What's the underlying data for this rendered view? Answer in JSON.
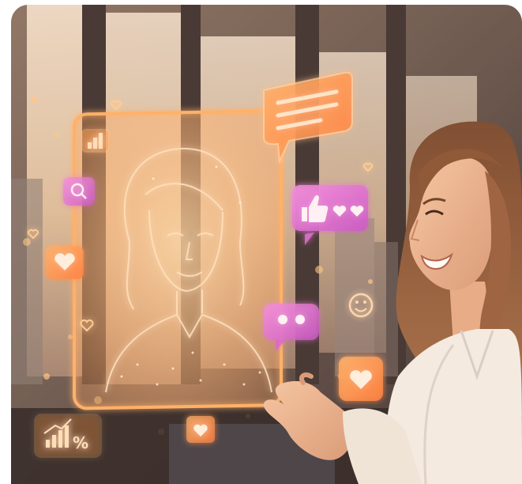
{
  "scene": {
    "subject": "woman-smiling",
    "hologram": "holographic-portrait-panel",
    "icons": [
      "bar-chart-icon",
      "search-icon",
      "heart-icon",
      "thumbs-up-heart-icon",
      "chat-icon",
      "smiley-icon",
      "growth-chart-icon"
    ]
  },
  "hologram": {
    "growth_label": "%"
  },
  "colors": {
    "hologram_glow": "#ffb26b",
    "bubble_pink": "#ee66d6",
    "bubble_orange": "#ff9a4a",
    "window_light": "#f7e3c8"
  }
}
